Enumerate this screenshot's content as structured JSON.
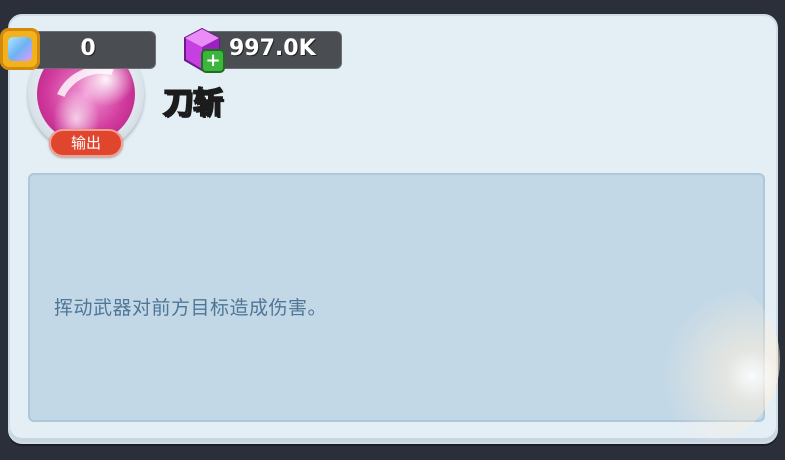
{
  "currency": {
    "gems": {
      "value": "0",
      "icon": "gem-icon"
    },
    "crystals": {
      "value": "997.0K",
      "icon": "purple-crystal-icon",
      "add_icon": "plus-icon"
    }
  },
  "skill": {
    "name": "刀斩",
    "role": "输出",
    "description": "挥动武器对前方目标造成伤害。",
    "orb_color": "#d23c9e"
  },
  "colors": {
    "panel": "#e4eef5",
    "desc_box": "#c3d8e6",
    "desc_text": "#4f7696",
    "role_badge": "#e0462e"
  }
}
